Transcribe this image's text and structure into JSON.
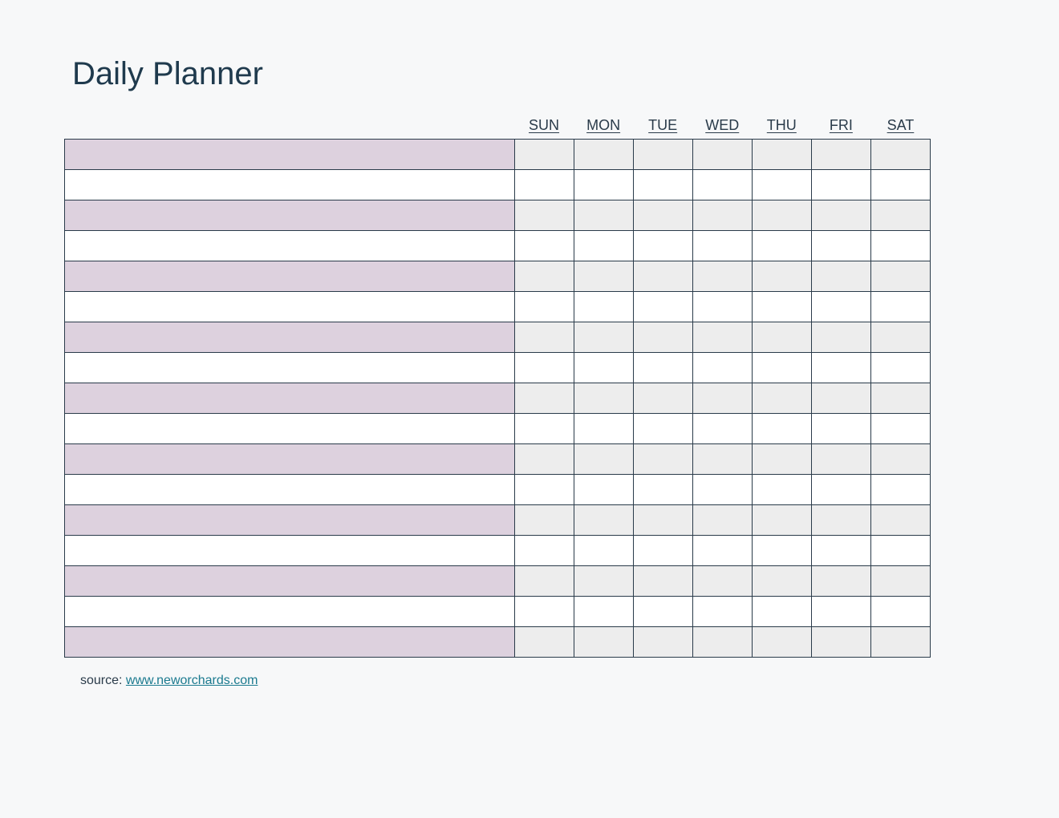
{
  "title": "Daily Planner",
  "days": [
    "SUN",
    "MON",
    "TUE",
    "WED",
    "THU",
    "FRI",
    "SAT"
  ],
  "rows": 17,
  "source": {
    "label": "source: ",
    "link_text": "www.neworchards.com"
  },
  "colors": {
    "odd_task_bg": "#ddd1de",
    "odd_day_bg": "#ededed",
    "even_bg": "#ffffff",
    "border": "#2a3b4a",
    "title": "#1f3a4d",
    "link": "#1b7a8f"
  }
}
